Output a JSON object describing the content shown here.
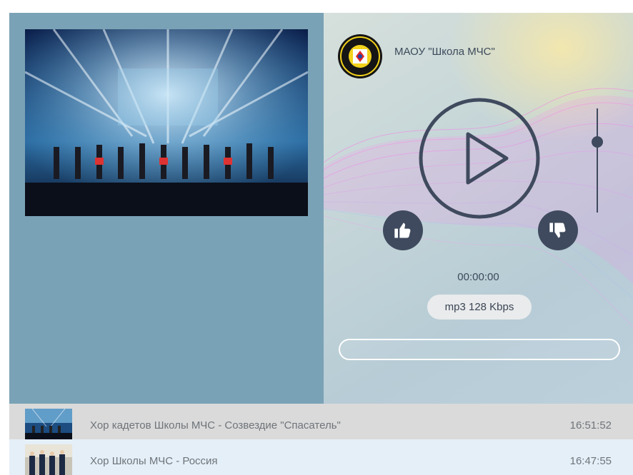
{
  "station": {
    "name": "МАОУ \"Школа МЧС\""
  },
  "player": {
    "timer": "00:00:00",
    "bitrate": "mp3 128 Kbps",
    "progress": 0,
    "volume": 0.7
  },
  "colors": {
    "left_panel": "#7aa2b6",
    "controls": "#3f4a5e",
    "row_active": "#dadada",
    "row_alt": "#e4eff8"
  },
  "playlist": [
    {
      "title": "Хор кадетов Школы МЧС - Созвездие \"Спасатель\"",
      "time": "16:51:52"
    },
    {
      "title": "Хор Школы МЧС - Россия",
      "time": "16:47:55"
    }
  ],
  "icons": {
    "play": "play-icon",
    "like": "thumbs-up-icon",
    "dislike": "thumbs-down-icon",
    "logo": "school-emblem-icon"
  }
}
